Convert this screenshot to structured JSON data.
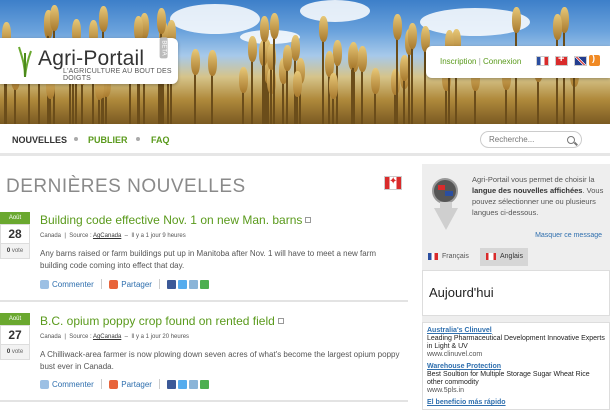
{
  "header": {
    "logo_title": "Agri-Portail",
    "logo_tagline": "L'AGRICULTURE AU BOUT DES DOIGTS",
    "beta_label": "BETA",
    "login_label": "Inscription",
    "login_separator": "|",
    "connect_label": "Connexion",
    "flags": [
      "france-flag",
      "switzerland-flag",
      "uk-flag"
    ],
    "rss_icon": "rss-icon"
  },
  "nav": {
    "items": [
      "NOUVELLES",
      "PUBLIER",
      "FAQ"
    ],
    "active_index": 0,
    "search_placeholder": "Recherche..."
  },
  "main": {
    "title": "DERNIÈRES NOUVELLES",
    "articles": [
      {
        "month": "Août",
        "day": "28",
        "votes": "0",
        "votes_label": "vote",
        "title": "Building code effective Nov. 1 on new Man. barns",
        "country": "Canada",
        "source_label": "Source :",
        "source": "AgCanada",
        "time": "Il y a 1 jour 9 heures",
        "body": "Any barns raised or farm buildings put up in Manitoba after Nov. 1 will have to meet a new farm building code coming into effect that day.",
        "comment_label": "Commenter",
        "share_label": "Partager"
      },
      {
        "month": "Août",
        "day": "27",
        "votes": "0",
        "votes_label": "vote",
        "title": "B.C. opium poppy crop found on rented field",
        "country": "Canada",
        "source_label": "Source :",
        "source": "AgCanada",
        "time": "Il y a 1 jour 20 heures",
        "body": "A Chilliwack-area farmer is now plowing down seven acres of what's become the largest opium poppy bust ever in Canada.",
        "comment_label": "Commenter",
        "share_label": "Partager"
      }
    ]
  },
  "sidebar": {
    "lang_text_1": "Agri-Portail vous permet de choisir la",
    "lang_text_bold": "langue des nouvelles affichées",
    "lang_text_2": ". Vous pouvez sélectionner une ou plusieurs langues ci-dessous.",
    "hide_label": "Masquer ce message",
    "languages": [
      "Français",
      "Anglais"
    ],
    "active_language_index": 1,
    "today_label": "Aujourd'hui",
    "ads": [
      {
        "title": "Australia's Clinuvel",
        "text": "Leading Pharmaceutical Development Innovative Experts in Light & UV",
        "url": "www.clinuvel.com"
      },
      {
        "title": "Warehouse Protection",
        "text": "Best Soultion for Multiple Storage Sugar Wheat Rice other commodity",
        "url": "www.5pls.in"
      },
      {
        "title": "El beneficio más rápido",
        "text": "",
        "url": ""
      }
    ]
  }
}
